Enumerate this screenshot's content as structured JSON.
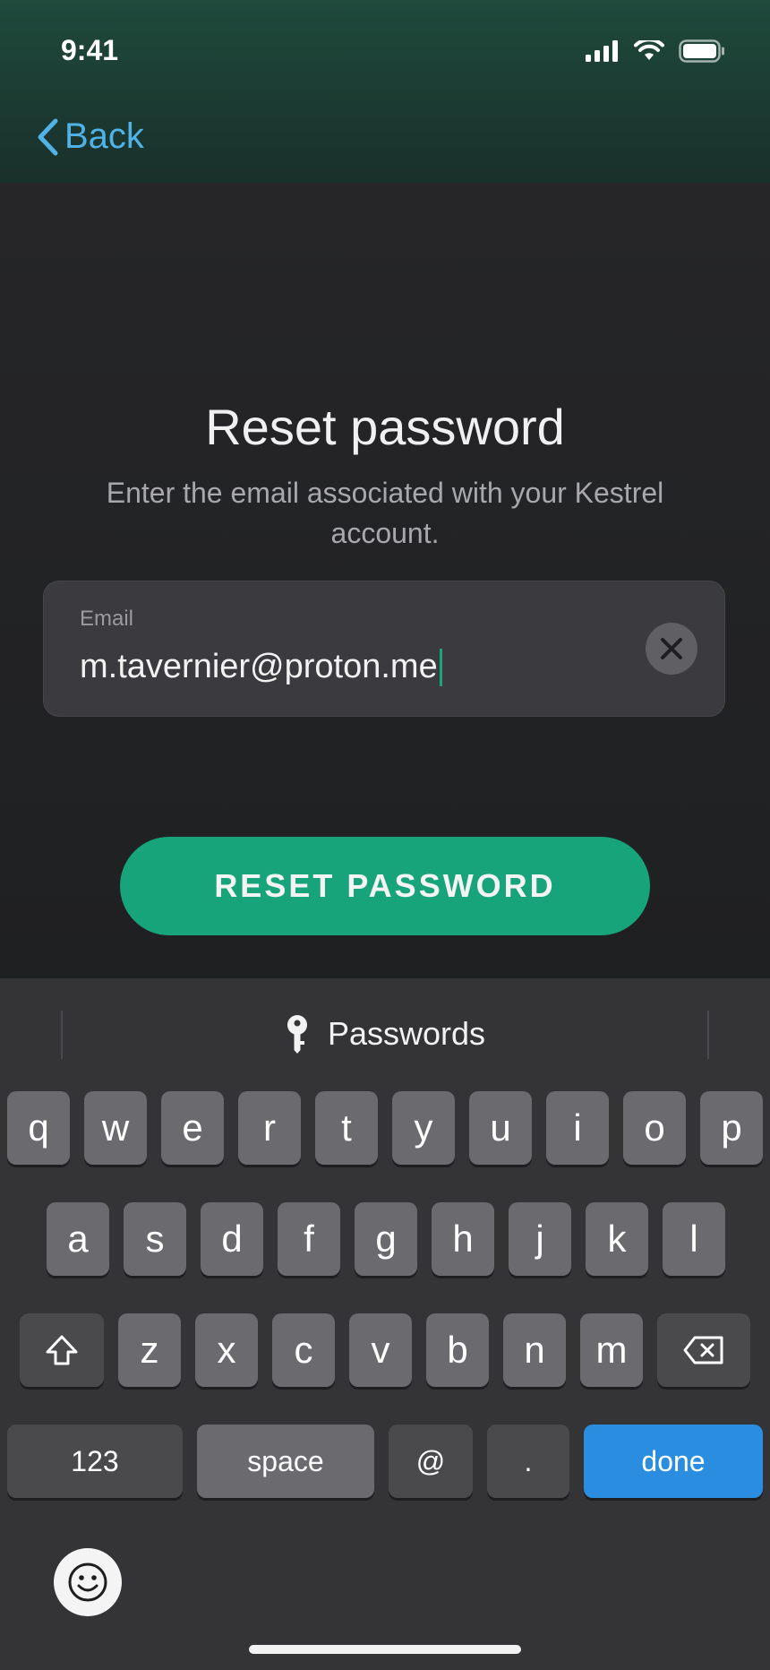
{
  "status_bar": {
    "time": "9:41"
  },
  "nav": {
    "back_label": "Back"
  },
  "main": {
    "title": "Reset password",
    "subtitle": "Enter the email associated with your Kestrel account.",
    "email_label": "Email",
    "email_value": "m.tavernier@proton.me",
    "reset_button": "RESET PASSWORD"
  },
  "keyboard": {
    "suggestion": "Passwords",
    "row1": [
      "q",
      "w",
      "e",
      "r",
      "t",
      "y",
      "u",
      "i",
      "o",
      "p"
    ],
    "row2": [
      "a",
      "s",
      "d",
      "f",
      "g",
      "h",
      "j",
      "k",
      "l"
    ],
    "row3": [
      "z",
      "x",
      "c",
      "v",
      "b",
      "n",
      "m"
    ],
    "row4": {
      "numbers": "123",
      "space": "space",
      "at": "@",
      "dot": ".",
      "done": "done"
    }
  },
  "colors": {
    "accent_green": "#17a47a",
    "link_blue": "#4fb3e8",
    "done_blue": "#2a8de0"
  }
}
